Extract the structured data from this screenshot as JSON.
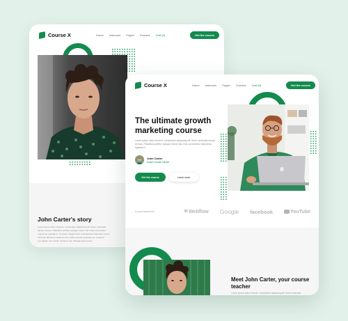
{
  "brand": {
    "name": "Course X"
  },
  "nav": {
    "links": [
      "Home",
      "Instructor",
      "Pages",
      "Courses",
      "Cart (0)"
    ],
    "cta": "Get the course"
  },
  "back_card": {
    "story_title": "John Carter's story",
    "story_lines": [
      "Lorem ipsum dolor sit amet, consectetur adipiscing elit. Amet, venenatis",
      "dictum at risus. Phasellus porttitor quisque rutrum hac Cras consectetur",
      "maecenas egestas in. Ut ipsum integer lacus velit faucibus bibendum purus",
      "vehicula. Elit lacus pharetra sed, nullam semper gravida nec, pharetra",
      "Leo aliquet sed ut felis. Vivamus elit, Volutpat vitae purus."
    ]
  },
  "front_card": {
    "hero_title": "The ultimate growth marketing course",
    "hero_text": "Lorem ipsum dolor sit amet, consectetur adipiscing elit. Amet, venenatis dictum at risus. Phasellus porttitor quisque rutrum hac Cras consectetur maecenas egestas in.",
    "author_name": "John Carter",
    "author_role": "Expert Growth Hacker",
    "primary_button": "Get the course",
    "secondary_button": "Learn more",
    "featured_label": "Course featured on",
    "brands": [
      "Webflow",
      "Google",
      "facebook",
      "YouTube"
    ],
    "meet_title": "Meet John Carter, your course teacher",
    "meet_text": "Lorem ipsum dolor sit amet, consectetur adipiscing elit. Amet venenatis."
  }
}
